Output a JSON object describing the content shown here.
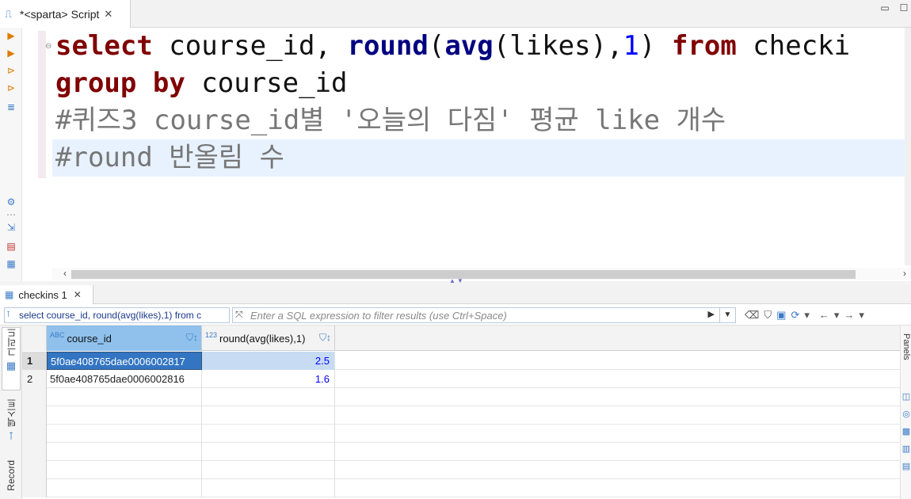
{
  "editor_tab": {
    "icon": "sql-script-icon",
    "label": "*<sparta> Script",
    "close": "✕"
  },
  "code": {
    "line1": {
      "t1": "select",
      "t2": " course_id, ",
      "t3": "round",
      "t4": "(",
      "t5": "avg",
      "t6": "(likes),",
      "t7": "1",
      "t8": ") ",
      "t9": "from",
      "t10": " checki"
    },
    "line2": {
      "t1": "group",
      "t2": " ",
      "t3": "by",
      "t4": " course_id"
    },
    "line3": "#퀴즈3 course_id별 '오늘의 다짐' 평균 like 개수",
    "line4": "#round 반올림 수"
  },
  "result_tab": {
    "icon": "table-icon",
    "label": "checkins 1",
    "close": "✕"
  },
  "filter": {
    "query_preview": "select course_id, round(avg(likes),1) from c",
    "placeholder": "Enter a SQL expression to filter results (use Ctrl+Space)"
  },
  "vertical_tabs": {
    "grid": "그리드",
    "text": "텍스트",
    "record": "Record"
  },
  "right_panel": {
    "label": "Panels"
  },
  "grid": {
    "columns": [
      {
        "type_badge": "ABC",
        "name": "course_id"
      },
      {
        "type_badge": "123",
        "name": "round(avg(likes),1)"
      }
    ],
    "rows": [
      {
        "num": "1",
        "course_id": "5f0ae408765dae0006002817",
        "value": "2.5"
      },
      {
        "num": "2",
        "course_id": "5f0ae408765dae0006002816",
        "value": "1.6"
      }
    ]
  },
  "colors": {
    "keyword": "#800000",
    "function": "#000080",
    "number": "#0000ff",
    "comment": "#777777",
    "selection": "#3375c2",
    "header_selected": "#8fc1ec"
  }
}
